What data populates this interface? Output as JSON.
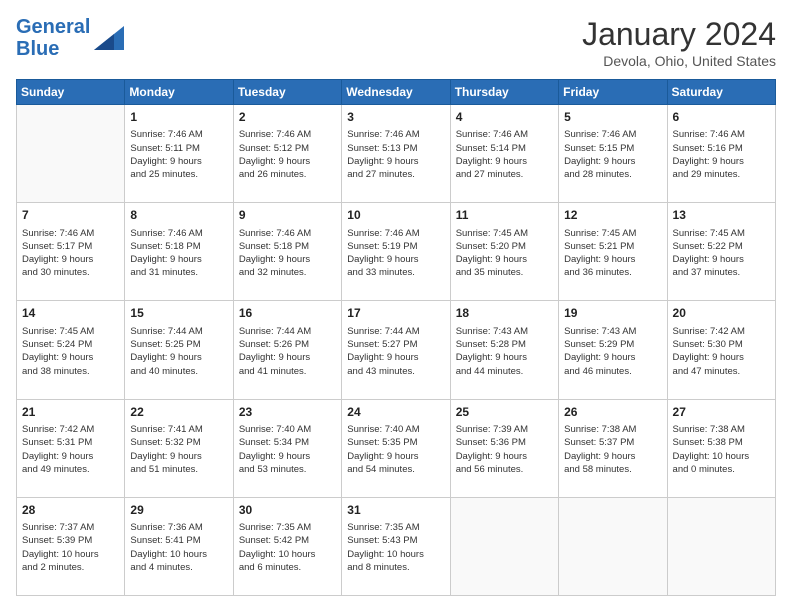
{
  "header": {
    "logo_line1": "General",
    "logo_line2": "Blue",
    "month": "January 2024",
    "location": "Devola, Ohio, United States"
  },
  "weekdays": [
    "Sunday",
    "Monday",
    "Tuesday",
    "Wednesday",
    "Thursday",
    "Friday",
    "Saturday"
  ],
  "weeks": [
    [
      {
        "day": "",
        "text": ""
      },
      {
        "day": "1",
        "text": "Sunrise: 7:46 AM\nSunset: 5:11 PM\nDaylight: 9 hours\nand 25 minutes."
      },
      {
        "day": "2",
        "text": "Sunrise: 7:46 AM\nSunset: 5:12 PM\nDaylight: 9 hours\nand 26 minutes."
      },
      {
        "day": "3",
        "text": "Sunrise: 7:46 AM\nSunset: 5:13 PM\nDaylight: 9 hours\nand 27 minutes."
      },
      {
        "day": "4",
        "text": "Sunrise: 7:46 AM\nSunset: 5:14 PM\nDaylight: 9 hours\nand 27 minutes."
      },
      {
        "day": "5",
        "text": "Sunrise: 7:46 AM\nSunset: 5:15 PM\nDaylight: 9 hours\nand 28 minutes."
      },
      {
        "day": "6",
        "text": "Sunrise: 7:46 AM\nSunset: 5:16 PM\nDaylight: 9 hours\nand 29 minutes."
      }
    ],
    [
      {
        "day": "7",
        "text": "Sunrise: 7:46 AM\nSunset: 5:17 PM\nDaylight: 9 hours\nand 30 minutes."
      },
      {
        "day": "8",
        "text": "Sunrise: 7:46 AM\nSunset: 5:18 PM\nDaylight: 9 hours\nand 31 minutes."
      },
      {
        "day": "9",
        "text": "Sunrise: 7:46 AM\nSunset: 5:18 PM\nDaylight: 9 hours\nand 32 minutes."
      },
      {
        "day": "10",
        "text": "Sunrise: 7:46 AM\nSunset: 5:19 PM\nDaylight: 9 hours\nand 33 minutes."
      },
      {
        "day": "11",
        "text": "Sunrise: 7:45 AM\nSunset: 5:20 PM\nDaylight: 9 hours\nand 35 minutes."
      },
      {
        "day": "12",
        "text": "Sunrise: 7:45 AM\nSunset: 5:21 PM\nDaylight: 9 hours\nand 36 minutes."
      },
      {
        "day": "13",
        "text": "Sunrise: 7:45 AM\nSunset: 5:22 PM\nDaylight: 9 hours\nand 37 minutes."
      }
    ],
    [
      {
        "day": "14",
        "text": "Sunrise: 7:45 AM\nSunset: 5:24 PM\nDaylight: 9 hours\nand 38 minutes."
      },
      {
        "day": "15",
        "text": "Sunrise: 7:44 AM\nSunset: 5:25 PM\nDaylight: 9 hours\nand 40 minutes."
      },
      {
        "day": "16",
        "text": "Sunrise: 7:44 AM\nSunset: 5:26 PM\nDaylight: 9 hours\nand 41 minutes."
      },
      {
        "day": "17",
        "text": "Sunrise: 7:44 AM\nSunset: 5:27 PM\nDaylight: 9 hours\nand 43 minutes."
      },
      {
        "day": "18",
        "text": "Sunrise: 7:43 AM\nSunset: 5:28 PM\nDaylight: 9 hours\nand 44 minutes."
      },
      {
        "day": "19",
        "text": "Sunrise: 7:43 AM\nSunset: 5:29 PM\nDaylight: 9 hours\nand 46 minutes."
      },
      {
        "day": "20",
        "text": "Sunrise: 7:42 AM\nSunset: 5:30 PM\nDaylight: 9 hours\nand 47 minutes."
      }
    ],
    [
      {
        "day": "21",
        "text": "Sunrise: 7:42 AM\nSunset: 5:31 PM\nDaylight: 9 hours\nand 49 minutes."
      },
      {
        "day": "22",
        "text": "Sunrise: 7:41 AM\nSunset: 5:32 PM\nDaylight: 9 hours\nand 51 minutes."
      },
      {
        "day": "23",
        "text": "Sunrise: 7:40 AM\nSunset: 5:34 PM\nDaylight: 9 hours\nand 53 minutes."
      },
      {
        "day": "24",
        "text": "Sunrise: 7:40 AM\nSunset: 5:35 PM\nDaylight: 9 hours\nand 54 minutes."
      },
      {
        "day": "25",
        "text": "Sunrise: 7:39 AM\nSunset: 5:36 PM\nDaylight: 9 hours\nand 56 minutes."
      },
      {
        "day": "26",
        "text": "Sunrise: 7:38 AM\nSunset: 5:37 PM\nDaylight: 9 hours\nand 58 minutes."
      },
      {
        "day": "27",
        "text": "Sunrise: 7:38 AM\nSunset: 5:38 PM\nDaylight: 10 hours\nand 0 minutes."
      }
    ],
    [
      {
        "day": "28",
        "text": "Sunrise: 7:37 AM\nSunset: 5:39 PM\nDaylight: 10 hours\nand 2 minutes."
      },
      {
        "day": "29",
        "text": "Sunrise: 7:36 AM\nSunset: 5:41 PM\nDaylight: 10 hours\nand 4 minutes."
      },
      {
        "day": "30",
        "text": "Sunrise: 7:35 AM\nSunset: 5:42 PM\nDaylight: 10 hours\nand 6 minutes."
      },
      {
        "day": "31",
        "text": "Sunrise: 7:35 AM\nSunset: 5:43 PM\nDaylight: 10 hours\nand 8 minutes."
      },
      {
        "day": "",
        "text": ""
      },
      {
        "day": "",
        "text": ""
      },
      {
        "day": "",
        "text": ""
      }
    ]
  ]
}
